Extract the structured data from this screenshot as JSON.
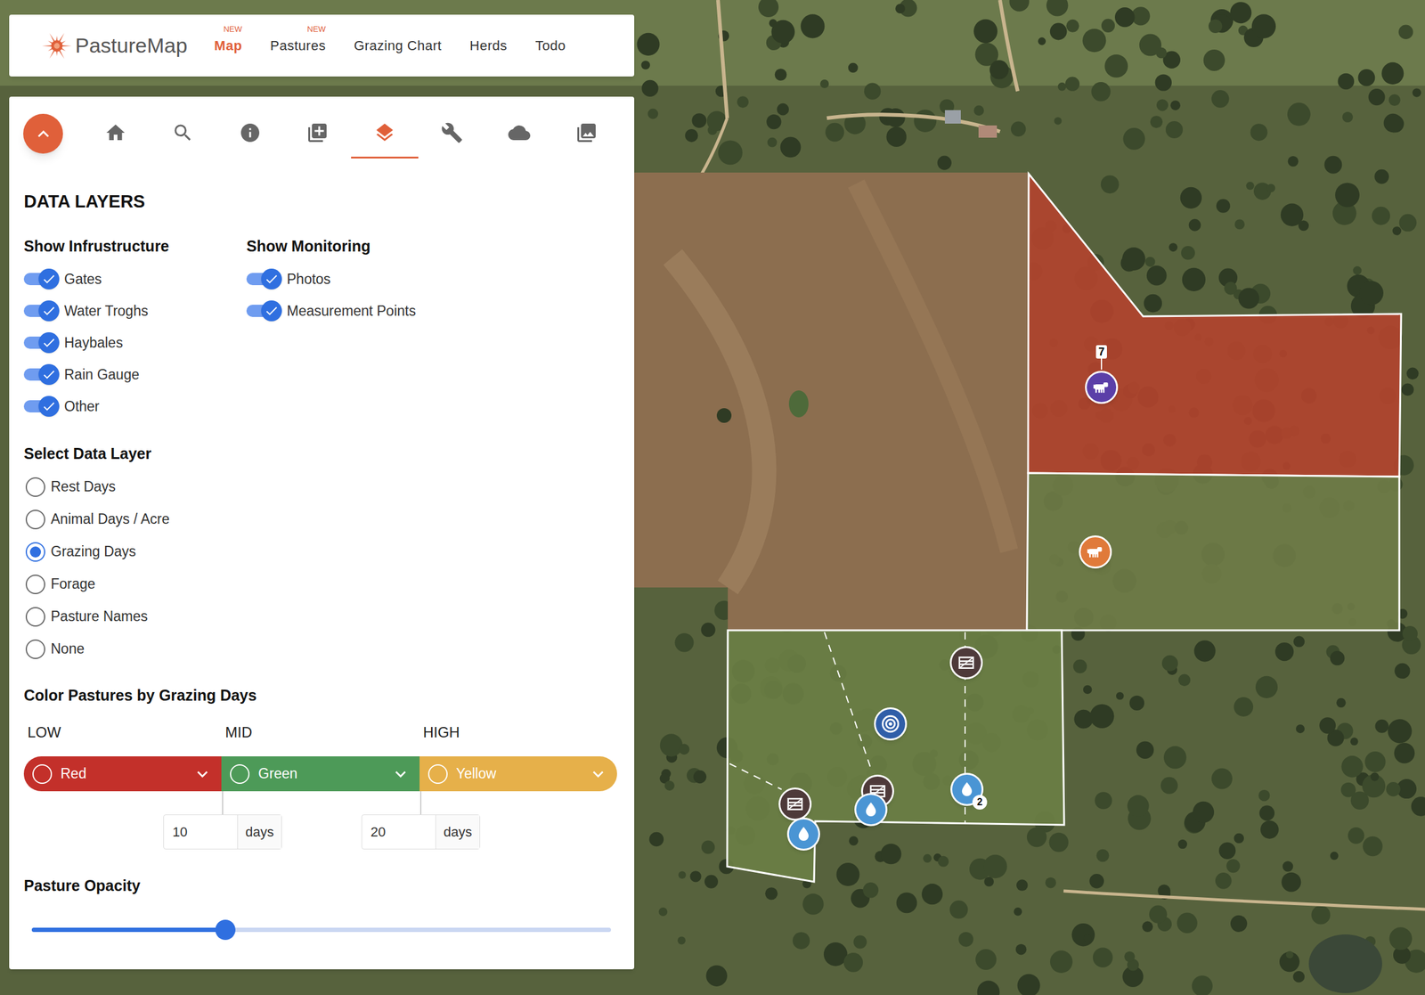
{
  "app": {
    "logo": "PastureMap"
  },
  "nav": [
    {
      "label": "Map",
      "badge": "NEW",
      "selected": true
    },
    {
      "label": "Pastures",
      "badge": "NEW",
      "selected": false
    },
    {
      "label": "Grazing Chart",
      "selected": false
    },
    {
      "label": "Herds",
      "selected": false
    },
    {
      "label": "Todo",
      "selected": false
    }
  ],
  "toolbar": [
    {
      "selected": false
    },
    {
      "selected": false
    },
    {
      "selected": false
    },
    {
      "selected": false
    },
    {
      "selected": true
    },
    {
      "selected": false
    },
    {
      "selected": false
    },
    {
      "selected": false
    }
  ],
  "panel": {
    "title": "DATA LAYERS",
    "infrastructure": {
      "title": "Show Infrustructure",
      "items": [
        {
          "label": "Gates",
          "on": true
        },
        {
          "label": "Water Troghs",
          "on": true
        },
        {
          "label": "Haybales",
          "on": true
        },
        {
          "label": "Rain Gauge",
          "on": true
        },
        {
          "label": "Other",
          "on": true
        }
      ]
    },
    "monitoring": {
      "title": "Show Monitoring",
      "items": [
        {
          "label": "Photos",
          "on": true
        },
        {
          "label": "Measurement Points",
          "on": true
        }
      ]
    },
    "data_layer": {
      "title": "Select Data Layer",
      "options": [
        {
          "label": "Rest Days",
          "selected": false
        },
        {
          "label": "Animal Days / Acre",
          "selected": false
        },
        {
          "label": "Grazing Days",
          "selected": true
        },
        {
          "label": "Forage",
          "selected": false
        },
        {
          "label": "Pasture Names",
          "selected": false
        },
        {
          "label": "None",
          "selected": false
        }
      ]
    },
    "color_scale": {
      "title": "Color Pastures by Grazing Days",
      "levels": [
        {
          "label": "LOW",
          "color_name": "Red",
          "color": "#c3302a"
        },
        {
          "label": "MID",
          "color_name": "Green",
          "color": "#4d9a58"
        },
        {
          "label": "HIGH",
          "color_name": "Yellow",
          "color": "#e6b04a"
        }
      ],
      "thresholds": [
        {
          "value": "10",
          "unit": "days"
        },
        {
          "value": "20",
          "unit": "days"
        }
      ]
    },
    "opacity": {
      "title": "Pasture Opacity",
      "level": 0.334
    }
  },
  "map": {
    "pastures": [
      {
        "color": "#b4442d"
      },
      {
        "color": "#6f7c47"
      },
      {
        "color": "#6c7f45"
      }
    ],
    "pins": [
      {
        "kind": "herd",
        "color": "#5b3fa8",
        "count": "7"
      },
      {
        "kind": "herd",
        "color": "#e07a3a"
      },
      {
        "kind": "gate"
      },
      {
        "kind": "measurement"
      },
      {
        "kind": "gate"
      },
      {
        "kind": "gate"
      },
      {
        "kind": "water"
      },
      {
        "kind": "water"
      },
      {
        "kind": "water",
        "count": "2"
      }
    ]
  }
}
